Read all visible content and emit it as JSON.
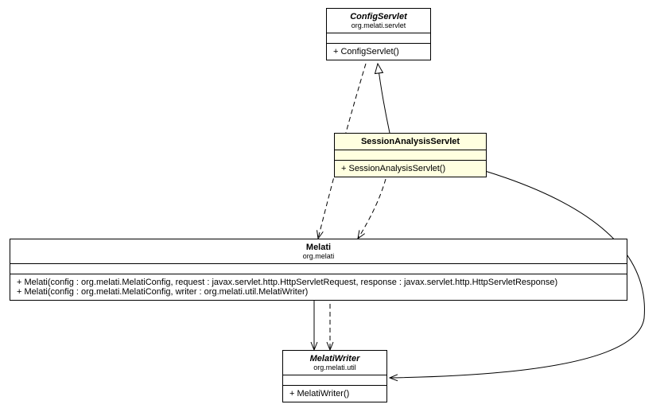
{
  "classes": {
    "configServlet": {
      "name": "ConfigServlet",
      "package": "org.melati.servlet",
      "methods": [
        "+ ConfigServlet()"
      ]
    },
    "sessionAnalysisServlet": {
      "name": "SessionAnalysisServlet",
      "methods": [
        "+ SessionAnalysisServlet()"
      ]
    },
    "melati": {
      "name": "Melati",
      "package": "org.melati",
      "methods": [
        "+ Melati(config : org.melati.MelatiConfig, request : javax.servlet.http.HttpServletRequest, response : javax.servlet.http.HttpServletResponse)",
        "+ Melati(config : org.melati.MelatiConfig, writer : org.melati.util.MelatiWriter)"
      ]
    },
    "melatiWriter": {
      "name": "MelatiWriter",
      "package": "org.melati.util",
      "methods": [
        "+ MelatiWriter()"
      ]
    }
  },
  "chart_data": {
    "type": "uml-class-diagram",
    "nodes": [
      {
        "id": "ConfigServlet",
        "package": "org.melati.servlet",
        "abstract": true,
        "methods": [
          "+ ConfigServlet()"
        ]
      },
      {
        "id": "SessionAnalysisServlet",
        "abstract": false,
        "methods": [
          "+ SessionAnalysisServlet()"
        ],
        "highlighted": true
      },
      {
        "id": "Melati",
        "package": "org.melati",
        "abstract": false,
        "methods": [
          "+ Melati(config : org.melati.MelatiConfig, request : javax.servlet.http.HttpServletRequest, response : javax.servlet.http.HttpServletResponse)",
          "+ Melati(config : org.melati.MelatiConfig, writer : org.melati.util.MelatiWriter)"
        ]
      },
      {
        "id": "MelatiWriter",
        "package": "org.melati.util",
        "abstract": true,
        "methods": [
          "+ MelatiWriter()"
        ]
      }
    ],
    "edges": [
      {
        "from": "SessionAnalysisServlet",
        "to": "ConfigServlet",
        "type": "generalization"
      },
      {
        "from": "ConfigServlet",
        "to": "Melati",
        "type": "dependency"
      },
      {
        "from": "SessionAnalysisServlet",
        "to": "Melati",
        "type": "dependency"
      },
      {
        "from": "SessionAnalysisServlet",
        "to": "MelatiWriter",
        "type": "association"
      },
      {
        "from": "Melati",
        "to": "MelatiWriter",
        "type": "association"
      },
      {
        "from": "Melati",
        "to": "MelatiWriter",
        "type": "dependency"
      }
    ]
  }
}
